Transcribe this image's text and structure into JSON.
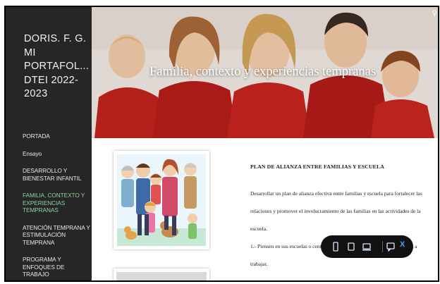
{
  "site": {
    "title_lines": [
      "DORIS. F. G.",
      "MI",
      "PORTAFOL...",
      "DTEI 2022-",
      "2023"
    ]
  },
  "nav": {
    "items": [
      {
        "label": "PORTADA",
        "active": false
      },
      {
        "label": "Ensayo",
        "active": false
      },
      {
        "label": "DESARROLLO Y BIENESTAR INFANTIL",
        "active": false
      },
      {
        "label": "FAMILIA, CONTEXTO Y EXPERIENCIAS TEMPRANAS",
        "active": true
      },
      {
        "label": "ATENCIÓN TEMPRANA Y ESTIMULACIÓN TEMPRANA",
        "active": false
      },
      {
        "label": "PROGRAMA Y ENFOQUES DE TRABAJO",
        "active": false
      }
    ]
  },
  "hero": {
    "title": "Familia, contexto y experiencias tempranas"
  },
  "article": {
    "heading": "PLAN DE ALIANZA ENTRE FAMILIAS Y ESCUELA",
    "paragraph1": "Desarrollar un plan de alianza efectiva entre familias y escuela para fortalecer las relaciones y promover el involucramiento de las familias en las actividades de la escuela.",
    "paragraph2": "1.- Piensen en sus escuelas o centro escuela o centro infantil sobre el que van a trabajar."
  },
  "toolbar": {
    "close_label": "X"
  },
  "colors": {
    "sidebar_bg": "#262626",
    "active_nav": "#8fd39d",
    "toolbar_bg": "#111111",
    "toolbar_accent": "#4aa3ff"
  }
}
